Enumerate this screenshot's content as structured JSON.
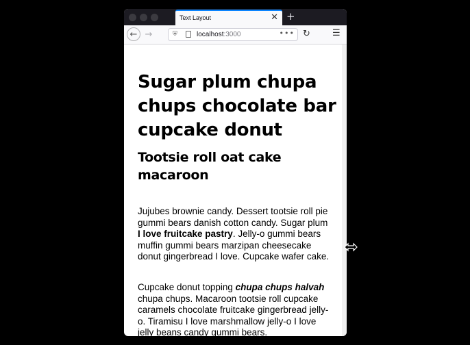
{
  "browser": {
    "tab_title": "Text Layout",
    "tab_close": "✕",
    "new_tab": "+",
    "url_host": "localhost",
    "url_port": ":3000",
    "url_more": "•••"
  },
  "article": {
    "heading": "Sugar plum chupa chups chocolate bar cupcake donut",
    "subheading": "Tootsie roll oat cake macaroon",
    "p1": {
      "before": "Jujubes brownie candy. Dessert tootsie roll pie gummi bears danish cotton candy. Sugar plum ",
      "bold": "I love fruitcake pastry",
      "after": ". Jelly-o gummi bears muffin gummi bears marzipan cheesecake donut gingerbread I love. Cupcake wafer cake."
    },
    "p2": {
      "before": "Cupcake donut topping ",
      "bold_italic": "chupa chups halvah",
      "after": " chupa chups. Macaroon tootsie roll cupcake caramels chocolate fruitcake gingerbread jelly-o. Tiramisu I love marshmallow jelly-o I love jelly beans candy gummi bears."
    }
  },
  "icons": {
    "back": "back-arrow-icon",
    "forward": "forward-arrow-icon",
    "reload": "reload-icon",
    "menu": "hamburger-menu-icon",
    "resize_cursor": "horizontal-resize-cursor-icon"
  }
}
